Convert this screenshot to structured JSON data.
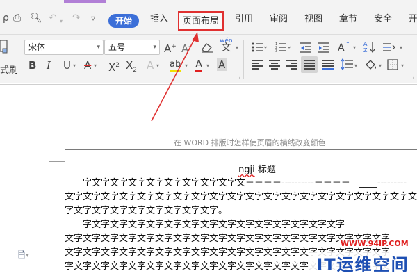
{
  "quick_access": {
    "print_icon": "printer-icon",
    "preview_icon": "print-preview-icon",
    "undo_icon": "undo-icon",
    "redo_icon": "redo-icon",
    "customize_icon": "customize-dropdown-icon"
  },
  "tabs": {
    "start": "开始",
    "insert": "插入",
    "page_layout": "页面布局",
    "references": "引用",
    "review": "审阅",
    "view": "视图",
    "chapter": "章节",
    "security": "安全",
    "dev_partial": "开"
  },
  "ribbon": {
    "format_painter_partial": "式刷",
    "font_name": "宋体",
    "font_size": "五号",
    "bold": "B",
    "italic": "I",
    "underline": "U",
    "strike": "A",
    "superscript_base": "X",
    "superscript_mark": "2",
    "subscript_base": "X",
    "subscript_mark": "2",
    "text_effect": "A",
    "highlight": "ab",
    "font_color": "A",
    "char_shading": "A",
    "grow_font": "A",
    "shrink_font": "A",
    "pinyin": "wén",
    "pinyin_char": "文"
  },
  "document": {
    "header_text": "在 WORD 排版时怎样使页眉的横线改变颜色",
    "title_word": "ngji",
    "title_rest": " 标题",
    "paragraphs": [
      "字文字文字文字文字文字文字文字文字文－－－－----------－－－－　____---------",
      "文字文字文字文字文字文字文字文字文字文字文字文字文字文字文字文字文字文字文字文",
      "字文字文字文字文字文字文字文字文字。",
      "字文字文字文字文字文字文字文字文字文字文字文字文字文字文字",
      "文字文字文字文字文字文字文字文字文字文字文字文字文字文字文字文字文字文字",
      "文字文字文字文字文字文字文字文字文字文字文字文字文字文字文字文字文字文字",
      "字文字文字文字文字文字文字文字文字文字文字文字文字文字文字文字文字文字文"
    ]
  },
  "watermark": {
    "url": "WWW.94IP.COM",
    "logo_text": "IT运维空间"
  },
  "colors": {
    "start_tab_bg": "#3c6fd8",
    "highlight_box": "#e03030",
    "annotation_arrow": "#e03030",
    "watermark_blue": "#1d4fb3",
    "watermark_red": "#e02020"
  }
}
